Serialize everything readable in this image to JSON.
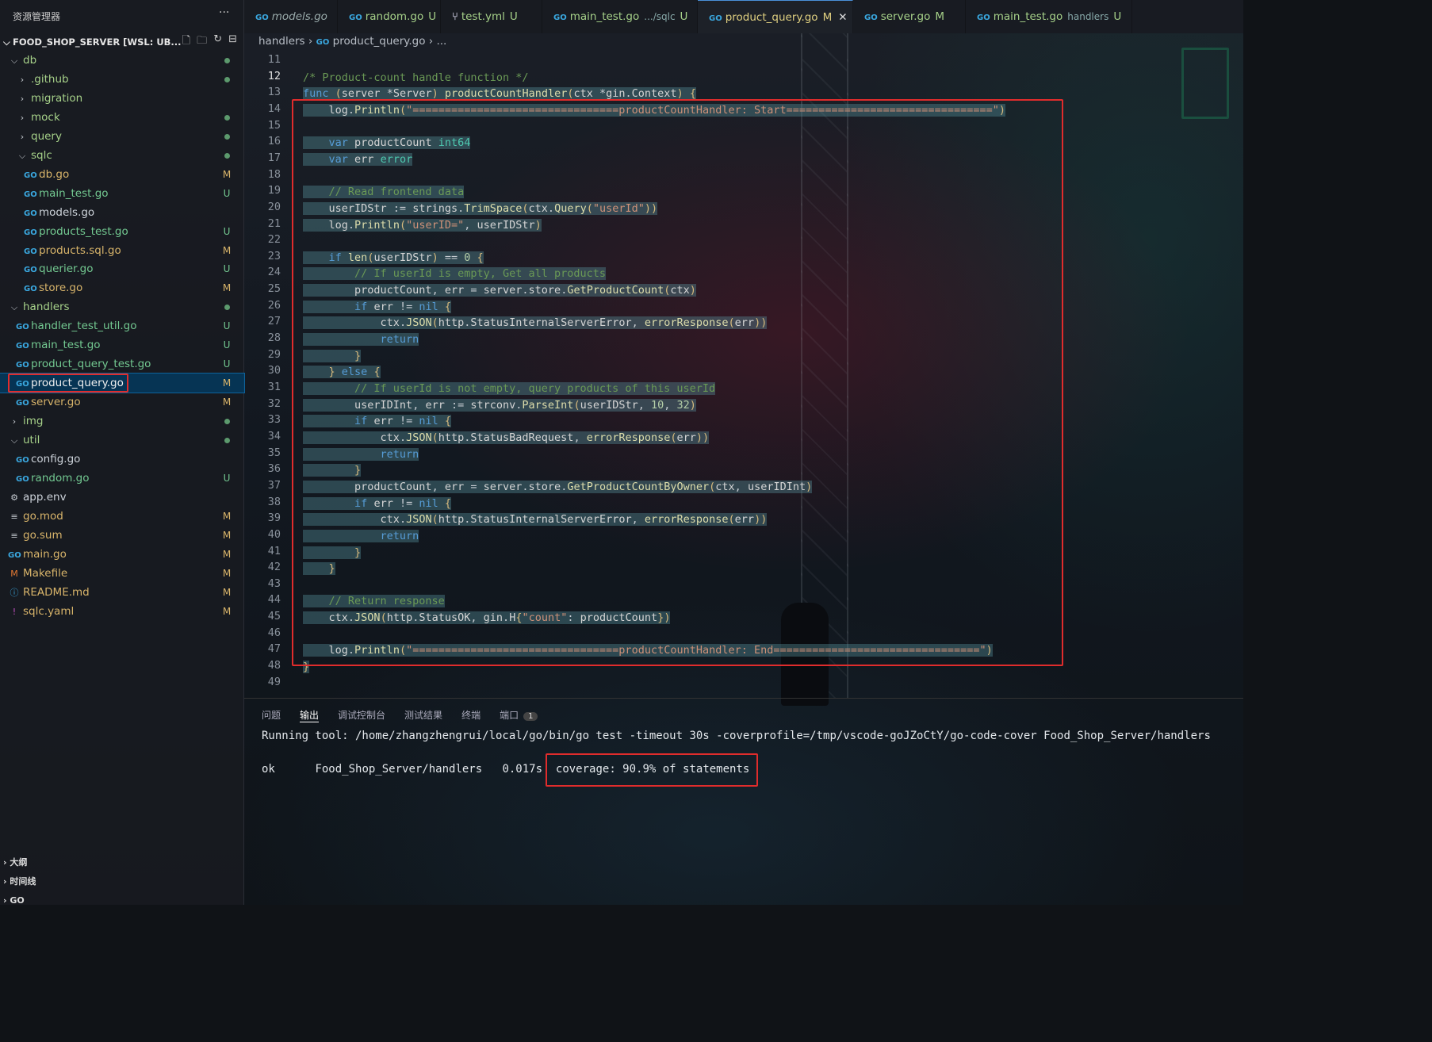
{
  "sidebar": {
    "title": "资源管理器",
    "more": "···",
    "project": "FOOD_SHOP_SERVER [WSL: UB...",
    "items": [
      {
        "label": "db",
        "icon": "chevron-down",
        "indent": 0,
        "kind": "folder",
        "status": "dot"
      },
      {
        "label": ".github",
        "icon": "chevron-right",
        "indent": 1,
        "kind": "folder",
        "status": "dot"
      },
      {
        "label": "migration",
        "icon": "chevron-right",
        "indent": 1,
        "kind": "folder",
        "status": ""
      },
      {
        "label": "mock",
        "icon": "chevron-right",
        "indent": 1,
        "kind": "folder",
        "status": "dot"
      },
      {
        "label": "query",
        "icon": "chevron-right",
        "indent": 1,
        "kind": "folder",
        "status": "dot"
      },
      {
        "label": "sqlc",
        "icon": "chevron-down",
        "indent": 1,
        "kind": "folder",
        "status": "dot"
      },
      {
        "label": "db.go",
        "icon": "go",
        "indent": 2,
        "kind": "mod",
        "status": "M"
      },
      {
        "label": "main_test.go",
        "icon": "go",
        "indent": 2,
        "kind": "untr",
        "status": "U"
      },
      {
        "label": "models.go",
        "icon": "go",
        "indent": 2,
        "kind": "plain",
        "status": ""
      },
      {
        "label": "products_test.go",
        "icon": "go",
        "indent": 2,
        "kind": "untr",
        "status": "U"
      },
      {
        "label": "products.sql.go",
        "icon": "go",
        "indent": 2,
        "kind": "mod",
        "status": "M"
      },
      {
        "label": "querier.go",
        "icon": "go",
        "indent": 2,
        "kind": "untr",
        "status": "U"
      },
      {
        "label": "store.go",
        "icon": "go",
        "indent": 2,
        "kind": "mod",
        "status": "M"
      },
      {
        "label": "handlers",
        "icon": "chevron-down",
        "indent": 0,
        "kind": "folder",
        "status": "dot"
      },
      {
        "label": "handler_test_util.go",
        "icon": "go",
        "indent": 1,
        "kind": "untr",
        "status": "U"
      },
      {
        "label": "main_test.go",
        "icon": "go",
        "indent": 1,
        "kind": "untr",
        "status": "U"
      },
      {
        "label": "product_query_test.go",
        "icon": "go",
        "indent": 1,
        "kind": "untr",
        "status": "U"
      },
      {
        "label": "product_query.go",
        "icon": "go",
        "indent": 1,
        "kind": "sel",
        "status": "M"
      },
      {
        "label": "server.go",
        "icon": "go",
        "indent": 1,
        "kind": "mod",
        "status": "M"
      },
      {
        "label": "img",
        "icon": "chevron-right",
        "indent": 0,
        "kind": "folder",
        "status": "dot"
      },
      {
        "label": "util",
        "icon": "chevron-down",
        "indent": 0,
        "kind": "folder",
        "status": "dot"
      },
      {
        "label": "config.go",
        "icon": "go",
        "indent": 1,
        "kind": "plain",
        "status": ""
      },
      {
        "label": "random.go",
        "icon": "go",
        "indent": 1,
        "kind": "untr",
        "status": "U"
      },
      {
        "label": "app.env",
        "icon": "gear",
        "indent": 0,
        "kind": "plain",
        "status": ""
      },
      {
        "label": "go.mod",
        "icon": "lines",
        "indent": 0,
        "kind": "mod",
        "status": "M"
      },
      {
        "label": "go.sum",
        "icon": "lines",
        "indent": 0,
        "kind": "mod",
        "status": "M"
      },
      {
        "label": "main.go",
        "icon": "go",
        "indent": 0,
        "kind": "mod",
        "status": "M"
      },
      {
        "label": "Makefile",
        "icon": "m",
        "indent": 0,
        "kind": "mod",
        "status": "M"
      },
      {
        "label": "README.md",
        "icon": "info",
        "indent": 0,
        "kind": "mod",
        "status": "M"
      },
      {
        "label": "sqlc.yaml",
        "icon": "bang",
        "indent": 0,
        "kind": "mod",
        "status": "M"
      }
    ],
    "bottom": [
      "大纲",
      "时间线",
      "GO"
    ]
  },
  "tabs": [
    {
      "name": "models.go",
      "status": "",
      "italic": true,
      "icon": "go"
    },
    {
      "name": "random.go",
      "status": "U",
      "icon": "go"
    },
    {
      "name": "test.yml",
      "status": "U",
      "icon": "branch"
    },
    {
      "name": "main_test.go",
      "path": ".../sqlc",
      "status": "U",
      "icon": "go"
    },
    {
      "name": "product_query.go",
      "status": "M",
      "active": true,
      "icon": "go",
      "close": "✕"
    },
    {
      "name": "server.go",
      "status": "M",
      "icon": "go"
    },
    {
      "name": "main_test.go",
      "path": "handlers",
      "status": "U",
      "icon": "go"
    }
  ],
  "breadcrumb": {
    "folder": "handlers",
    "file": "product_query.go",
    "rest": "..."
  },
  "code": {
    "line_numbers": [
      "11",
      "12",
      "13",
      "14",
      "15",
      "16",
      "17",
      "18",
      "19",
      "20",
      "21",
      "22",
      "23",
      "24",
      "25",
      "26",
      "27",
      "28",
      "29",
      "30",
      "31",
      "32",
      "33",
      "34",
      "35",
      "36",
      "37",
      "38",
      "39",
      "40",
      "41",
      "42",
      "43",
      "44",
      "45",
      "46",
      "47",
      "48",
      "49"
    ],
    "lines": [
      "",
      "/* Product-count handle function */",
      "func (server *Server) productCountHandler(ctx *gin.Context) {",
      "    log.Println(\"================================productCountHandler: Start================================\")",
      "",
      "    var productCount int64",
      "    var err error",
      "",
      "    // Read frontend data",
      "    userIDStr := strings.TrimSpace(ctx.Query(\"userId\"))",
      "    log.Println(\"userID=\", userIDStr)",
      "",
      "    if len(userIDStr) == 0 {",
      "        // If userId is empty, Get all products",
      "        productCount, err = server.store.GetProductCount(ctx)",
      "        if err != nil {",
      "            ctx.JSON(http.StatusInternalServerError, errorResponse(err))",
      "            return",
      "        }",
      "    } else {",
      "        // If userId is not empty, query products of this userId",
      "        userIDInt, err := strconv.ParseInt(userIDStr, 10, 32)",
      "        if err != nil {",
      "            ctx.JSON(http.StatusBadRequest, errorResponse(err))",
      "            return",
      "        }",
      "        productCount, err = server.store.GetProductCountByOwner(ctx, userIDInt)",
      "        if err != nil {",
      "            ctx.JSON(http.StatusInternalServerError, errorResponse(err))",
      "            return",
      "        }",
      "    }",
      "",
      "    // Return response",
      "    ctx.JSON(http.StatusOK, gin.H{\"count\": productCount})",
      "",
      "    log.Println(\"================================productCountHandler: End================================\")",
      "}",
      ""
    ]
  },
  "panel": {
    "tabs": [
      "问题",
      "输出",
      "调试控制台",
      "测试结果",
      "终端",
      "端口"
    ],
    "ports_badge": "1",
    "running": "Running tool: /home/zhangzhengrui/local/go/bin/go test -timeout 30s -coverprofile=/tmp/vscode-goJZoCtY/go-code-cover Food_Shop_Server/handlers",
    "result_ok": "ok",
    "result_pkg": "Food_Shop_Server/handlers",
    "result_time": "0.017s",
    "coverage": "coverage: 90.9% of statements"
  },
  "colors": {
    "highlight_box": "#e02c2c",
    "accent": "#4a90d9"
  }
}
